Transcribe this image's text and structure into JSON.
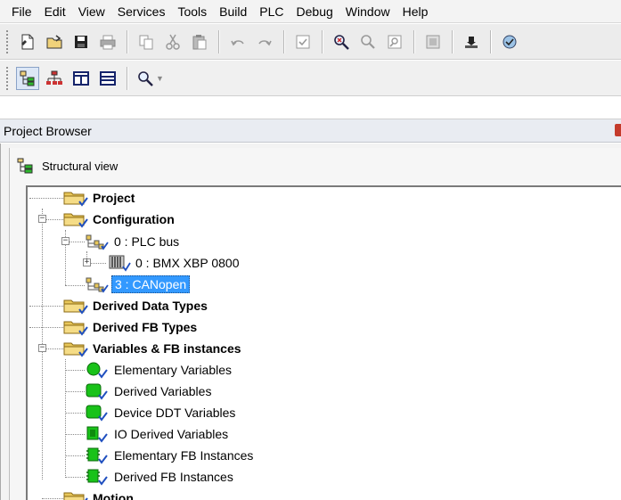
{
  "menu": [
    "File",
    "Edit",
    "View",
    "Services",
    "Tools",
    "Build",
    "PLC",
    "Debug",
    "Window",
    "Help"
  ],
  "toolbar1": [
    "new-icon",
    "open-icon",
    "save-icon",
    "print-icon",
    "copy-icon",
    "cut-icon",
    "paste-icon",
    "undo-icon",
    "redo-icon",
    "validate-icon",
    "find-icon",
    "replace-icon",
    "search-icon",
    "screen-icon",
    "export-icon",
    "analyze-icon"
  ],
  "toolbar2": [
    "structural-view-icon",
    "functional-view-icon",
    "horizontal-split-icon",
    "vertical-split-icon",
    "zoom-icon"
  ],
  "browser": {
    "title": "Project Browser",
    "view_label": "Structural view"
  },
  "tree": [
    {
      "label": "Project",
      "bold": true,
      "icon": "folder"
    },
    {
      "label": "Configuration",
      "bold": true,
      "icon": "folder"
    },
    {
      "label": "0 : PLC bus",
      "bold": false,
      "icon": "bus"
    },
    {
      "label": "0 : BMX XBP 0800",
      "bold": false,
      "icon": "rack"
    },
    {
      "label": "3 : CANopen",
      "bold": false,
      "icon": "bus",
      "selected": true
    },
    {
      "label": "Derived Data Types",
      "bold": true,
      "icon": "folder"
    },
    {
      "label": "Derived FB Types",
      "bold": true,
      "icon": "folder"
    },
    {
      "label": "Variables & FB instances",
      "bold": true,
      "icon": "folder"
    },
    {
      "label": "Elementary Variables",
      "bold": false,
      "icon": "var-circle"
    },
    {
      "label": "Derived Variables",
      "bold": false,
      "icon": "var-rect"
    },
    {
      "label": "Device DDT Variables",
      "bold": false,
      "icon": "var-rect"
    },
    {
      "label": "IO Derived Variables",
      "bold": false,
      "icon": "var-io"
    },
    {
      "label": "Elementary FB Instances",
      "bold": false,
      "icon": "fb"
    },
    {
      "label": "Derived FB Instances",
      "bold": false,
      "icon": "fb"
    },
    {
      "label": "Motion",
      "bold": true,
      "icon": "folder"
    }
  ],
  "colors": {
    "selection": "#3399ff",
    "folder": "#e8c75a",
    "variable_green": "#19c219",
    "check_blue": "#1f4fbf"
  }
}
